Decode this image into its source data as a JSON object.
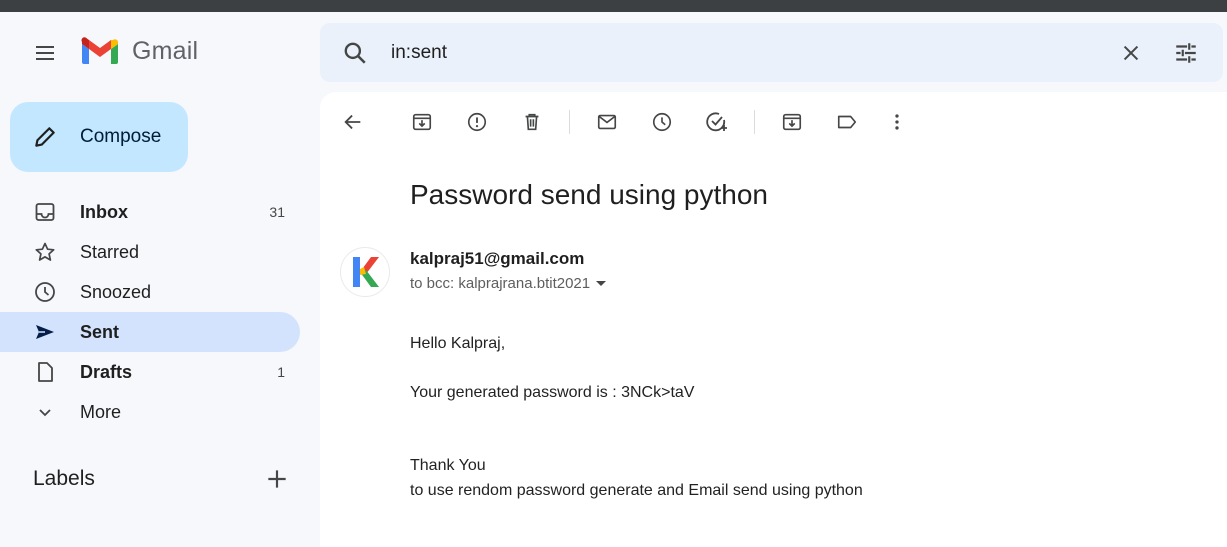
{
  "app": {
    "name": "Gmail"
  },
  "search": {
    "value": "in:sent"
  },
  "compose": {
    "label": "Compose"
  },
  "nav": [
    {
      "label": "Inbox",
      "count": "31",
      "bold": true,
      "icon": "inbox-icon"
    },
    {
      "label": "Starred",
      "count": "",
      "bold": false,
      "icon": "star-icon"
    },
    {
      "label": "Snoozed",
      "count": "",
      "bold": false,
      "icon": "clock-icon"
    },
    {
      "label": "Sent",
      "count": "",
      "bold": true,
      "active": true,
      "icon": "send-icon"
    },
    {
      "label": "Drafts",
      "count": "1",
      "bold": true,
      "icon": "draft-icon"
    },
    {
      "label": "More",
      "count": "",
      "bold": false,
      "icon": "chevron-down-icon"
    }
  ],
  "labels": {
    "heading": "Labels"
  },
  "message": {
    "subject": "Password send using python",
    "sender": "kalpraj51@gmail.com",
    "avatar_letter": "K",
    "recipients": "to bcc: kalprajrana.btit2021",
    "body": {
      "greeting": "Hello Kalpraj,",
      "password_line": "Your generated password is : 3NCk>taV",
      "thanks": "Thank You",
      "closing": "to use rendom password generate and Email send using python"
    }
  },
  "colors": {
    "background": "#f6f8fc",
    "compose": "#c2e7ff",
    "active_nav": "#d3e3fd",
    "search": "#eaf1fb"
  }
}
